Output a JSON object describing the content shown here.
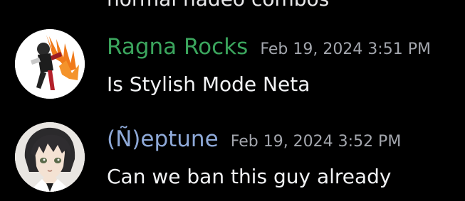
{
  "previous_message": {
    "text": "normal nadeo combos"
  },
  "messages": [
    {
      "username": "Ragna Rocks",
      "username_color": "#3ba55d",
      "timestamp": "Feb 19, 2024 3:51 PM",
      "text": "Is Stylish Mode Neta",
      "avatar_icon": "anime-character-avatar-icon"
    },
    {
      "username": "(Ñ)eptune",
      "username_color": "#8ea9d8",
      "timestamp": "Feb 19, 2024 3:52 PM",
      "text": "Can we ban this guy already",
      "avatar_icon": "anime-character-avatar-icon"
    }
  ]
}
